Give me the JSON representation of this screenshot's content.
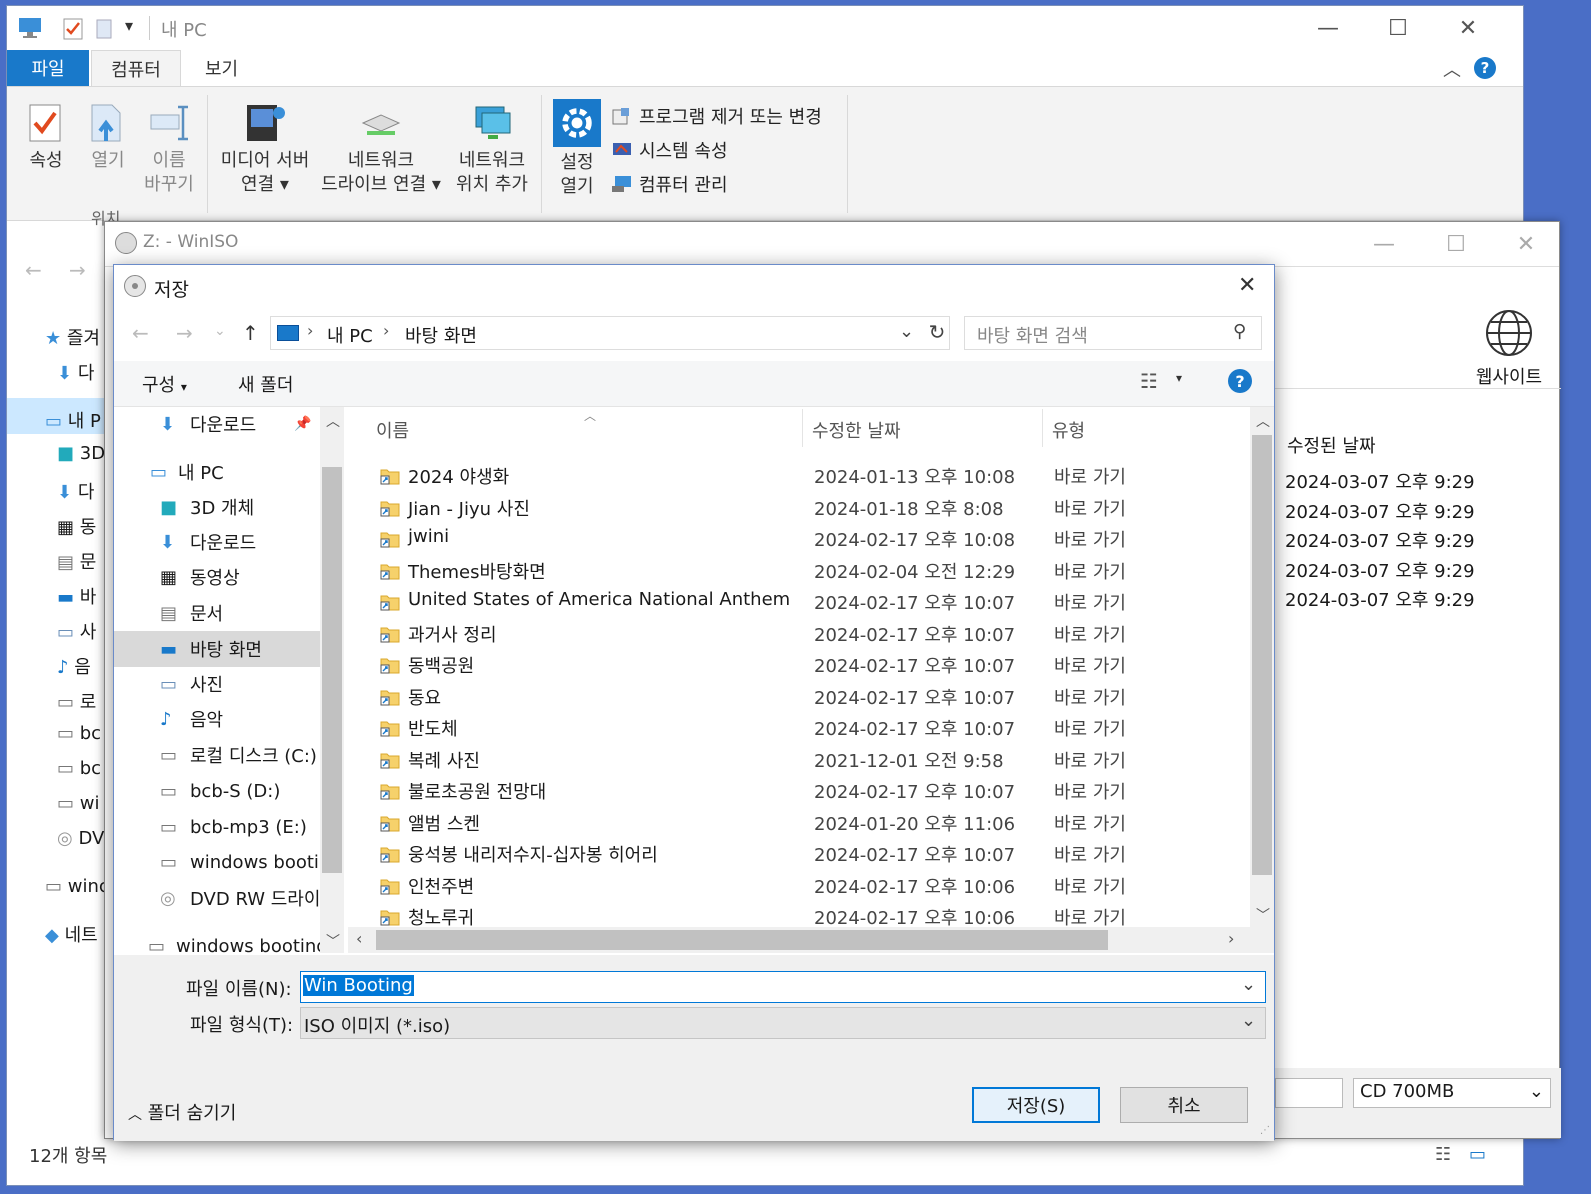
{
  "explorer": {
    "title": "내 PC",
    "tabs": [
      "파일",
      "컴퓨터",
      "보기"
    ],
    "ribbon": {
      "properties": "속성",
      "open": "열기",
      "rename_1": "이름",
      "rename_2": "바꾸기",
      "media_server_1": "미디어 서버",
      "media_server_2": "연결",
      "map_drive_1": "네트워크",
      "map_drive_2": "드라이브 연결",
      "add_location_1": "네트워크",
      "add_location_2": "위치 추가",
      "open_settings_1": "설정",
      "open_settings_2": "열기",
      "uninstall": "프로그램 제거 또는 변경",
      "system_props": "시스템 속성",
      "manage": "컴퓨터 관리",
      "group_loc_partial": "위치"
    },
    "nav": [
      "즐겨",
      "다",
      "내 P",
      "3D",
      "다",
      "동",
      "문",
      "바",
      "사",
      "음",
      "로",
      "bc",
      "bc",
      "wi",
      "DV",
      "winc",
      "네트"
    ],
    "status": "12개 항목"
  },
  "winiso": {
    "title": "Z: - WinISO",
    "website": "웹사이트",
    "col_modified": "수정된 날짜",
    "dates": [
      "2024-03-07 오후 9:29",
      "2024-03-07 오후 9:29",
      "2024-03-07 오후 9:29",
      "2024-03-07 오후 9:29",
      "2024-03-07 오후 9:29"
    ],
    "cd_size": "CD 700MB"
  },
  "dialog": {
    "title": "저장",
    "breadcrumb": [
      "내 PC",
      "바탕 화면"
    ],
    "search_placeholder": "바탕 화면 검색",
    "organize": "구성",
    "new_folder": "새 폴더",
    "columns": {
      "name": "이름",
      "date": "수정한 날짜",
      "type": "유형"
    },
    "nav": [
      {
        "label": "다운로드",
        "icon": "download-icon"
      },
      {
        "label": "내 PC",
        "icon": "pc-icon"
      },
      {
        "label": "3D 개체",
        "icon": "cube-icon"
      },
      {
        "label": "다운로드",
        "icon": "download-icon"
      },
      {
        "label": "동영상",
        "icon": "video-icon"
      },
      {
        "label": "문서",
        "icon": "document-icon"
      },
      {
        "label": "바탕 화면",
        "icon": "desktop-icon"
      },
      {
        "label": "사진",
        "icon": "picture-icon"
      },
      {
        "label": "음악",
        "icon": "music-icon"
      },
      {
        "label": "로컬 디스크 (C:)",
        "icon": "disk-icon"
      },
      {
        "label": "bcb-S (D:)",
        "icon": "drive-icon"
      },
      {
        "label": "bcb-mp3 (E:)",
        "icon": "drive-icon"
      },
      {
        "label": "windows bootin",
        "icon": "drive-icon"
      },
      {
        "label": "DVD RW 드라이",
        "icon": "dvd-icon"
      },
      {
        "label": "windows booting",
        "icon": "drive-icon"
      }
    ],
    "files": [
      {
        "name": "2024 야생화",
        "date": "2024-01-13 오후 10:08",
        "type": "바로 가기"
      },
      {
        "name": "Jian - Jiyu 사진",
        "date": "2024-01-18 오후 8:08",
        "type": "바로 가기"
      },
      {
        "name": "jwini",
        "date": "2024-02-17 오후 10:08",
        "type": "바로 가기"
      },
      {
        "name": "Themes바탕화면",
        "date": "2024-02-04 오전 12:29",
        "type": "바로 가기"
      },
      {
        "name": "United States of America National Anthem",
        "date": "2024-02-17 오후 10:07",
        "type": "바로 가기"
      },
      {
        "name": "과거사 정리",
        "date": "2024-02-17 오후 10:07",
        "type": "바로 가기"
      },
      {
        "name": "동백공원",
        "date": "2024-02-17 오후 10:07",
        "type": "바로 가기"
      },
      {
        "name": "동요",
        "date": "2024-02-17 오후 10:07",
        "type": "바로 가기"
      },
      {
        "name": "반도체",
        "date": "2024-02-17 오후 10:07",
        "type": "바로 가기"
      },
      {
        "name": "복례 사진",
        "date": "2021-12-01 오전 9:58",
        "type": "바로 가기"
      },
      {
        "name": "불로초공원 전망대",
        "date": "2024-02-17 오후 10:07",
        "type": "바로 가기"
      },
      {
        "name": "앨범 스켄",
        "date": "2024-01-20 오후 11:06",
        "type": "바로 가기"
      },
      {
        "name": "웅석봉 내리저수지-십자봉 히어리",
        "date": "2024-02-17 오후 10:07",
        "type": "바로 가기"
      },
      {
        "name": "인천주변",
        "date": "2024-02-17 오후 10:06",
        "type": "바로 가기"
      },
      {
        "name": "청노루귀",
        "date": "2024-02-17 오후 10:06",
        "type": "바로 가기"
      }
    ],
    "filename_label": "파일 이름(N):",
    "filename_value": "Win Booting",
    "filetype_label": "파일 형식(T):",
    "filetype_value": "ISO 이미지 (*.iso)",
    "hide_folders": "폴더 숨기기",
    "save": "저장(S)",
    "cancel": "취소"
  },
  "colors": {
    "accent": "#0063b1",
    "selection": "#cce8ff",
    "highlight": "#0078d7"
  }
}
